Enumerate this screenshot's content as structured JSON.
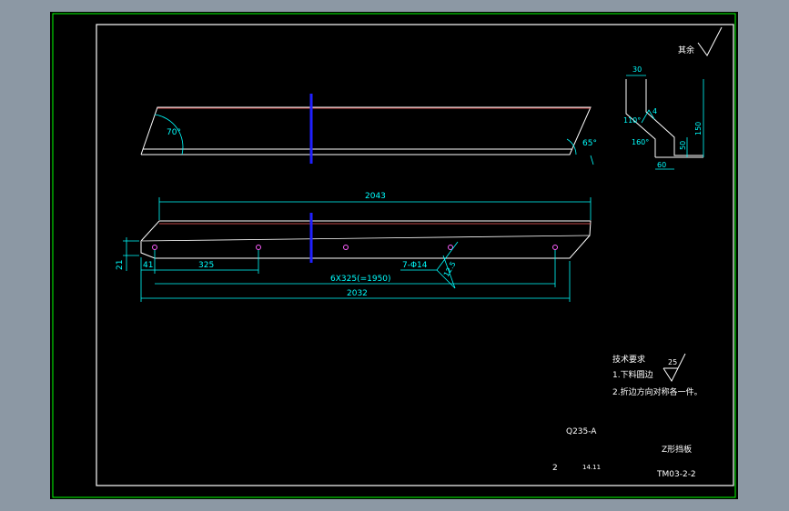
{
  "colors": {
    "background": "#8c98a4",
    "paper": "#000000",
    "outline": "#ffffff",
    "dimension": "#00ffff",
    "hidden_line": "#ff6060",
    "center_mark": "#2020ff",
    "hole": "#ff60ff",
    "frame": "#00ff00",
    "text": "#ffffff"
  },
  "top_view": {
    "angle_left": "70°",
    "angle_right": "65°"
  },
  "front_view": {
    "overall_length": "2043",
    "bottom_length": "2032",
    "edge_offset": "41",
    "hole_spacing": "325",
    "spacing_total": "6X325(=1950)",
    "hole_callout": "7-Φ14",
    "slope": "12.5",
    "height": "21"
  },
  "section": {
    "top_width": "30",
    "bottom_width": "60",
    "height": "150",
    "flange": "50",
    "angle_upper": "110°",
    "angle_lower": "160°",
    "thickness": "4"
  },
  "surface_finish": {
    "label": "其余"
  },
  "requirements": {
    "title": "技术要求",
    "line1": "1.下料圆边",
    "line2": "2.折边方向对称各一件。",
    "roughness": "25"
  },
  "title_block": {
    "material": "Q235-A",
    "part_name": "Z形挡板",
    "quantity": "2",
    "scale": "14.11",
    "drawing_number": "TM03-2-2"
  }
}
